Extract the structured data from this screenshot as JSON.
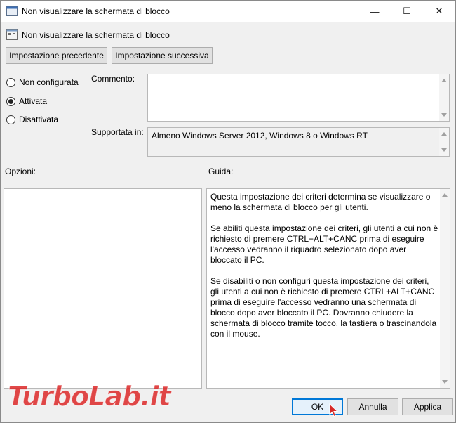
{
  "window": {
    "title": "Non visualizzare la schermata di blocco",
    "controls": {
      "minimize": "—",
      "maximize": "☐",
      "close": "✕"
    }
  },
  "policy": {
    "name": "Non visualizzare la schermata di blocco"
  },
  "nav": {
    "previous": "Impostazione precedente",
    "next": "Impostazione successiva"
  },
  "state": {
    "options": [
      {
        "label": "Non configurata",
        "selected": false
      },
      {
        "label": "Attivata",
        "selected": true
      },
      {
        "label": "Disattivata",
        "selected": false
      }
    ]
  },
  "comment": {
    "label": "Commento:",
    "value": ""
  },
  "supported": {
    "label": "Supportata in:",
    "value": "Almeno Windows Server 2012, Windows 8 o Windows RT"
  },
  "options_panel": {
    "label": "Opzioni:"
  },
  "help_panel": {
    "label": "Guida:",
    "paragraphs": [
      "Questa impostazione dei criteri determina se visualizzare o meno la schermata di blocco per gli utenti.",
      "Se abiliti questa impostazione dei criteri, gli utenti a cui non è richiesto di premere CTRL+ALT+CANC prima di eseguire l'accesso vedranno il riquadro selezionato dopo aver bloccato il PC.",
      "Se disabiliti o non configuri questa impostazione dei criteri, gli utenti a cui non è richiesto di premere CTRL+ALT+CANC prima di eseguire l'accesso vedranno una schermata di blocco dopo aver bloccato il PC. Dovranno chiudere la schermata di blocco tramite tocco, la tastiera o trascinandola con il mouse."
    ]
  },
  "footer": {
    "ok": "OK",
    "cancel": "Annulla",
    "apply": "Applica"
  },
  "watermark": "TurboLab.it",
  "colors": {
    "accent": "#0078d7",
    "watermark": "#dc2828"
  }
}
